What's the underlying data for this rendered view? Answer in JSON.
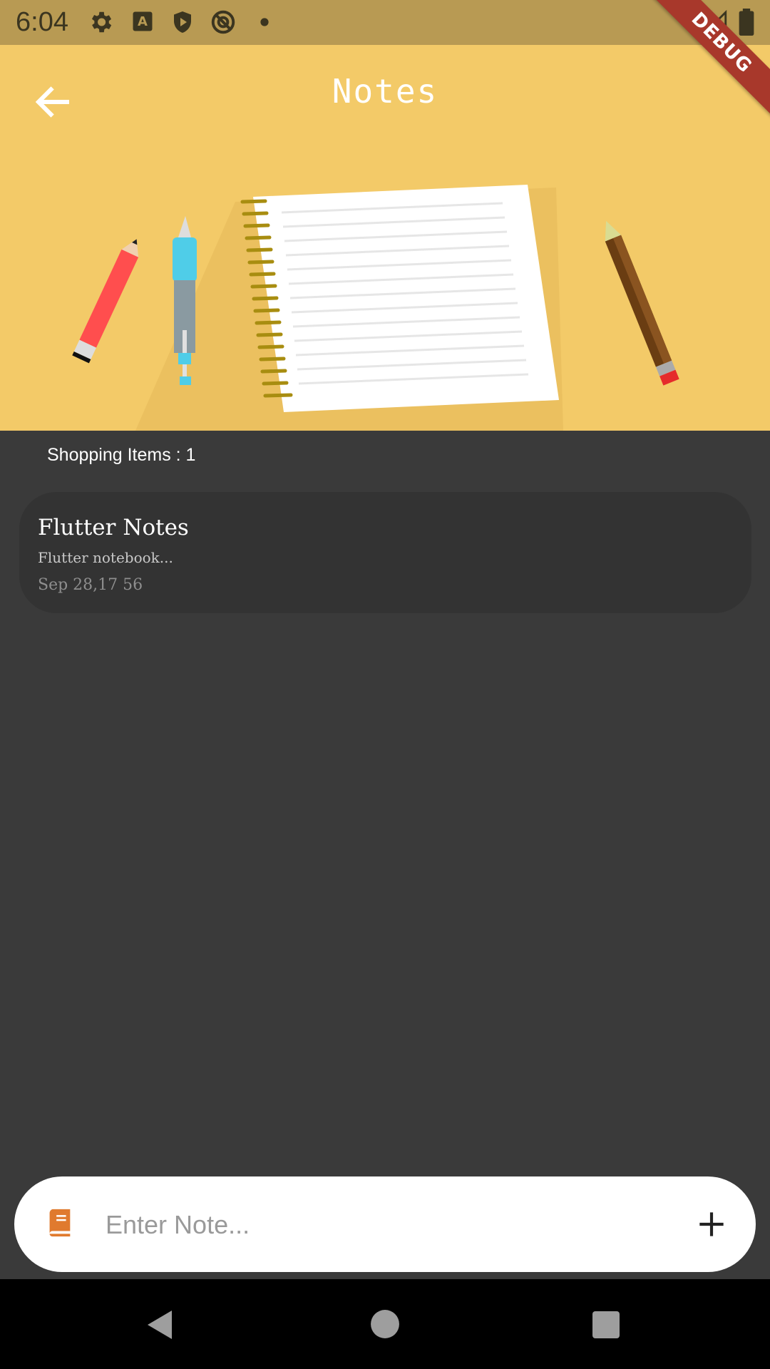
{
  "status_bar": {
    "time": "6:04",
    "icons": [
      "settings-icon",
      "keyboard-a-icon",
      "play-shield-icon",
      "no-sim-icon",
      "dot-icon",
      "signal-icon",
      "battery-icon"
    ]
  },
  "debug_banner": "DEBUG",
  "header": {
    "title": "Notes",
    "back_icon": "arrow-left-icon",
    "background_color": "#f3ca68"
  },
  "list": {
    "count_label": "Shopping Items : 1",
    "notes": [
      {
        "title": "Flutter Notes",
        "body": "Flutter notebook...",
        "date": "Sep 28,17 56"
      }
    ]
  },
  "input": {
    "placeholder": "Enter Note...",
    "value": "",
    "leading_icon": "book-icon",
    "trailing_icon": "plus-icon",
    "accent_color": "#e07a2e"
  },
  "nav_bar": {
    "buttons": [
      "back-triangle-icon",
      "home-circle-icon",
      "recents-square-icon"
    ]
  }
}
